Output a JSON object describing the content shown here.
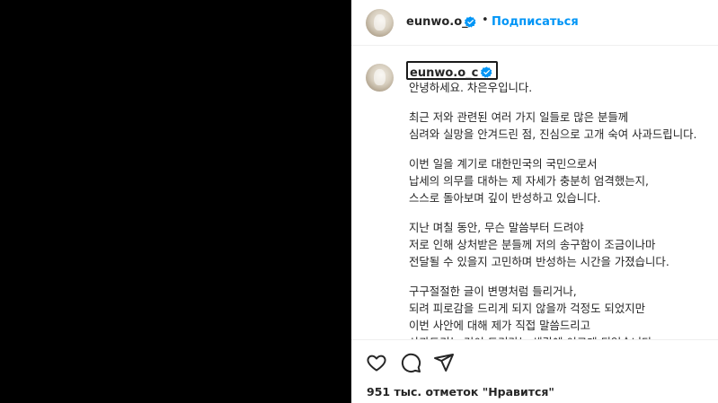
{
  "post": {
    "username": "eunwo.o_c",
    "follow_label": "Подписаться",
    "separator": "•"
  },
  "caption": {
    "paragraphs": [
      [
        "안녕하세요. 차은우입니다."
      ],
      [
        "최근 저와 관련된 여러 가지 일들로 많은 분들께",
        "심려와 실망을 안겨드린 점, 진심으로 고개 숙여 사과드립니다."
      ],
      [
        "이번 일을 계기로 대한민국의 국민으로서",
        "납세의 의무를 대하는 제 자세가 충분히 엄격했는지,",
        "스스로 돌아보며 깊이 반성하고 있습니다."
      ],
      [
        "지난 며칠 동안, 무슨 말씀부터 드려야",
        "저로 인해 상처받은 분들께 저의 송구함이 조금이나마",
        "전달될 수 있을지 고민하며 반성하는 시간을 가졌습니다."
      ],
      [
        "구구절절한 글이 변명처럼 들리거나,",
        "되려 피로감을 드리게 되지 않을까 걱정도 되었지만",
        "이번 사안에 대해 제가 직접 말씀드리고",
        "사과드리는 것이 도리라는 생각에 이르게 되었습니다."
      ]
    ]
  },
  "likes_text": "951 тыс. отметок \"Нравится\"",
  "icons": {
    "like": "heart-icon",
    "comment": "comment-icon",
    "share": "share-icon",
    "verified": "verified-badge-icon"
  },
  "colors": {
    "accent": "#0095f6",
    "verified": "#0095f6",
    "media_background": "#000000"
  }
}
